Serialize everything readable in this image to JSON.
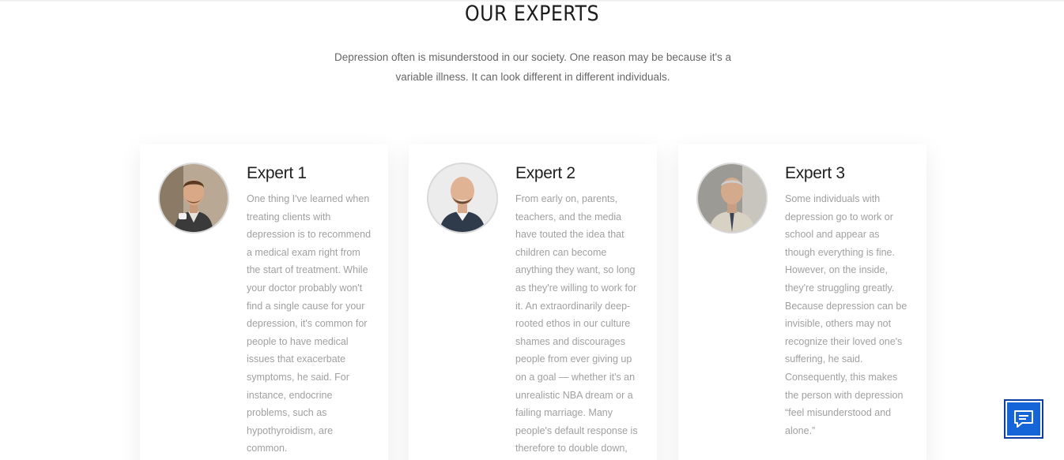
{
  "section": {
    "title": "OUR EXPERTS",
    "intro": "Depression often is misunderstood in our society. One reason may be because it's a variable illness. It can look different in different individuals."
  },
  "experts": [
    {
      "name": "Expert 1",
      "bio": "One thing I've learned when treating clients with depression is to recommend a medical exam right from the start of treatment. While your doctor probably won't find a single cause for your depression, it's common for people to have medical issues that exacerbate symptoms, he said. For instance, endocrine problems, such as hypothyroidism, are common."
    },
    {
      "name": "Expert 2",
      "bio": "From early on, parents, teachers, and the media have touted the idea that children can become anything they want, so long as they're willing to work for it. An extraordinarily deep-rooted ethos in our culture shames and discourages people from ever giving up on a goal — whether it's an unrealistic NBA dream or a failing marriage. Many people's default response is therefore to double down,"
    },
    {
      "name": "Expert 3",
      "bio": "Some individuals with depression go to work or school and appear as though everything is fine. However, on the inside, they're struggling greatly. Because depression can be invisible, others may not recognize their loved one's suffering, he said. Consequently, this makes the person with depression “feel misunderstood and alone.”"
    }
  ],
  "chat_widget": {
    "icon": "chat-bubble-icon",
    "color": "#1565d8"
  }
}
